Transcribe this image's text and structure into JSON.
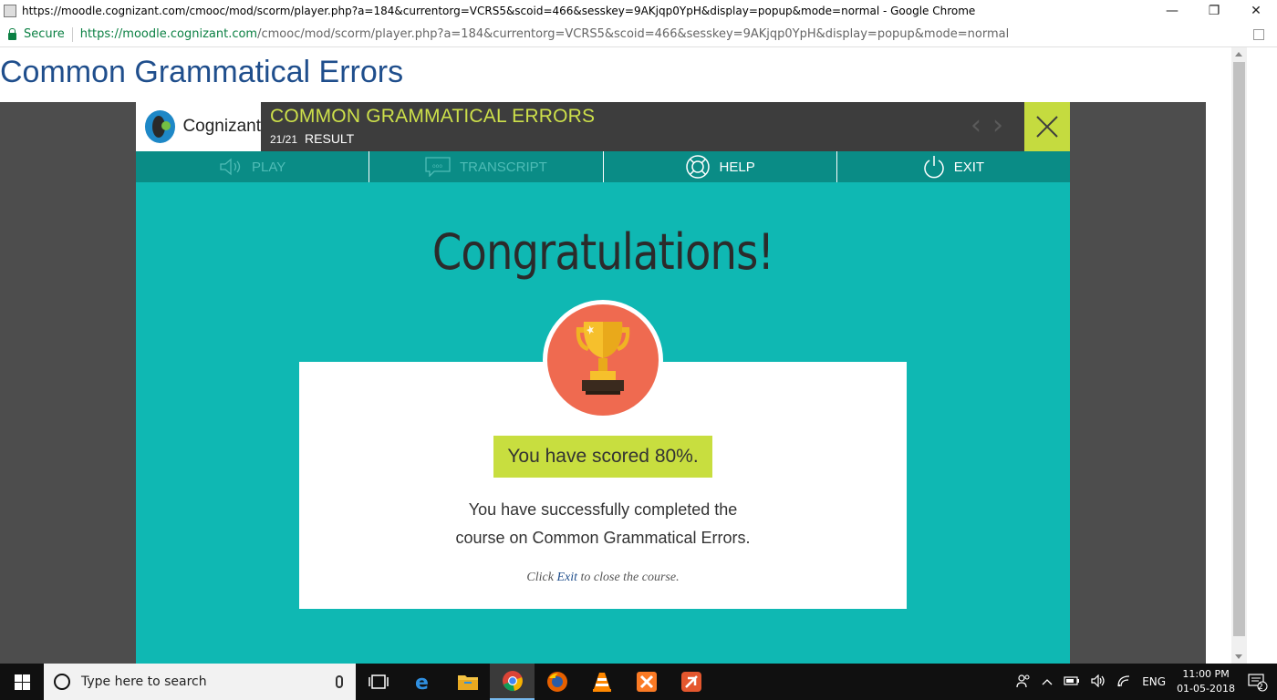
{
  "browser": {
    "window_title": "https://moodle.cognizant.com/cmooc/mod/scorm/player.php?a=184&currentorg=VCRS5&scoid=466&sesskey=9AKjqp0YpH&display=popup&mode=normal - Google Chrome",
    "secure_label": "Secure",
    "url_host": "https://moodle.cognizant.com",
    "url_rest": "/cmooc/mod/scorm/player.php?a=184&currentorg=VCRS5&scoid=466&sesskey=9AKjqp0YpH&display=popup&mode=normal",
    "controls": {
      "minimize": "—",
      "restore": "❐",
      "close": "✕"
    }
  },
  "page": {
    "heading": "Common Grammatical Errors"
  },
  "player": {
    "logo_text": "Cognizant",
    "course_title": "COMMON GRAMMATICAL ERRORS",
    "slide_count": "21/21",
    "slide_name": "RESULT",
    "toolbar": {
      "play": "PLAY",
      "transcript": "TRANSCRIPT",
      "help": "HELP",
      "exit": "EXIT"
    },
    "nav": {
      "prev": "‹",
      "next": "›"
    },
    "congrats": "Congratulations!",
    "score_text": "You have scored 80%.",
    "completion_line1": "You have successfully completed the",
    "completion_line2": "course on Common Grammatical Errors.",
    "exit_hint_prefix": "Click ",
    "exit_hint_link": "Exit",
    "exit_hint_suffix": " to close the course.",
    "colors": {
      "teal": "#0fb8b3",
      "lime": "#c8de3f",
      "header": "#3d3d3d",
      "trophy_bg": "#ef6a50"
    }
  },
  "taskbar": {
    "search_placeholder": "Type here to search",
    "apps": [
      "task-view-icon",
      "edge-icon",
      "file-explorer-icon",
      "chrome-icon",
      "firefox-icon",
      "vlc-icon",
      "xampp-icon",
      "filezilla-icon"
    ],
    "language": "ENG",
    "time": "11:00 PM",
    "date": "01-05-2018",
    "notification_count": "2"
  }
}
